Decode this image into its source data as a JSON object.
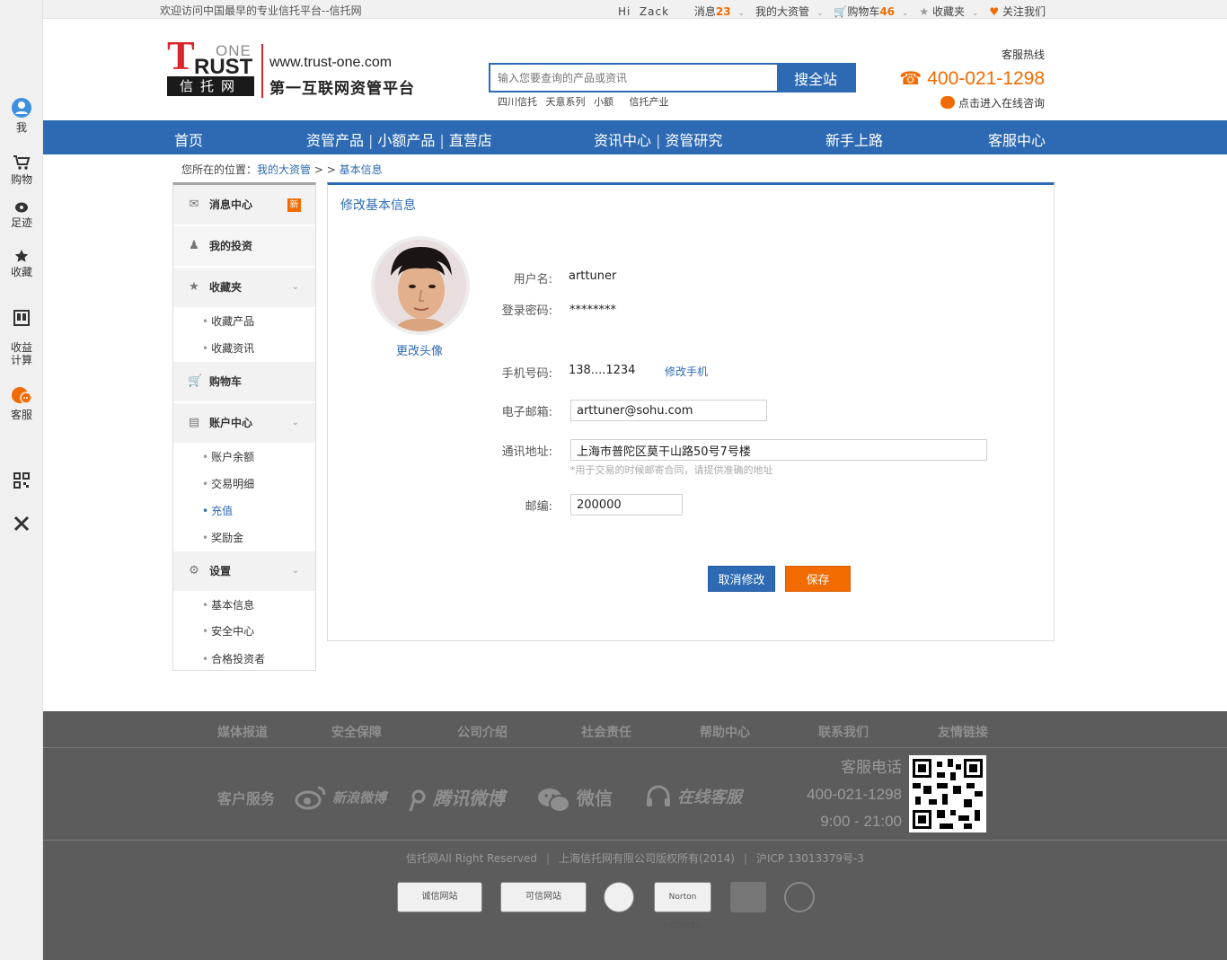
{
  "leftbar": {
    "items": [
      {
        "label": "我",
        "icon": "user-icon"
      },
      {
        "label": "购物",
        "icon": "cart-icon"
      },
      {
        "label": "足迹",
        "icon": "footprint-icon"
      },
      {
        "label": "收藏",
        "icon": "star-icon"
      },
      {
        "label": "收益\n计算",
        "icon": "calculator-icon"
      },
      {
        "label": "客服",
        "icon": "chat-icon"
      }
    ],
    "qr_icon": "qr-code-icon",
    "close_icon": "close-icon"
  },
  "topbar": {
    "welcome": "欢迎访问中国最早的专业信托平台--信托网",
    "greeting": "Hi  Zack",
    "messages_label": "消息",
    "messages_count": "23",
    "my_assets": "我的大资管",
    "cart_label": "购物车",
    "cart_count": "46",
    "favorites": "收藏夹",
    "follow": "关注我们"
  },
  "header": {
    "logo_one": "ONE",
    "logo_trust": "RUST",
    "logo_t": "T",
    "logo_cn": "信托网",
    "url": "www.trust-one.com",
    "slogan": "第一互联网资管平台",
    "search_placeholder": "输入您要查询的产品或资讯",
    "search_button": "搜全站",
    "hot_links": [
      "四川信托",
      "天意系列",
      "小额",
      "信托产业"
    ],
    "hotline_label": "客服热线",
    "hotline_number": "400-021-1298",
    "consult": "点击进入在线咨询"
  },
  "nav": {
    "home": "首页",
    "products": [
      "资管产品",
      "小额产品",
      "直营店"
    ],
    "info": [
      "资讯中心",
      "资管研究"
    ],
    "newbie": "新手上路",
    "service": "客服中心"
  },
  "breadcrumb": {
    "prefix": "您所在的位置：",
    "level1": "我的大资管",
    "sep": " > > ",
    "level2": "基本信息"
  },
  "sidemenu": {
    "messages": "消息中心",
    "new_badge": "新",
    "investments": "我的投资",
    "favorites": "收藏夹",
    "fav_products": "收藏产品",
    "fav_news": "收藏资讯",
    "cart": "购物车",
    "account": "账户中心",
    "balance": "账户余额",
    "transactions": "交易明细",
    "recharge": "充值",
    "bonus": "奖励金",
    "settings": "设置",
    "basic_info": "基本信息",
    "security": "安全中心",
    "qualified": "合格投资者"
  },
  "form": {
    "title": "修改基本信息",
    "change_avatar": "更改头像",
    "username_label": "用户名:",
    "username": "arttuner",
    "password_label": "登录密码:",
    "password": "********",
    "phone_label": "手机号码:",
    "phone": "138....1234",
    "change_phone": "修改手机",
    "email_label": "电子邮箱:",
    "email": "arttuner@sohu.com",
    "address_label": "通讯地址:",
    "address": "上海市普陀区莫干山路50号7号楼",
    "address_hint": "*用于交易的时候邮寄合同，请提供准确的地址",
    "zip_label": "邮编:",
    "zip": "200000",
    "cancel": "取消修改",
    "save": "保存"
  },
  "footer": {
    "links": [
      "媒体报道",
      "安全保障",
      "公司介绍",
      "社会责任",
      "帮助中心",
      "联系我们",
      "友情链接"
    ],
    "customer_service": "客户服务",
    "weibo_sina": "新浪微博",
    "weibo_tencent": "腾讯微博",
    "wechat": "微信",
    "online_service": "在线客服",
    "contact_label": "客服电话",
    "contact_phone": "400-021-1298",
    "contact_hours": "9:00 - 21:00",
    "copyright_1": "信托网All Right Reserved",
    "copyright_2": "上海信托网有限公司版权所有(2014)",
    "copyright_3": "沪ICP 13013379号-3",
    "badges": [
      "诚信网站",
      "可信网站",
      "Norton SECURED"
    ]
  },
  "colors": {
    "primary": "#2d6ab3",
    "accent": "#f26b00",
    "logo_red": "#d8262c",
    "footer_bg": "#5c5c5c"
  }
}
